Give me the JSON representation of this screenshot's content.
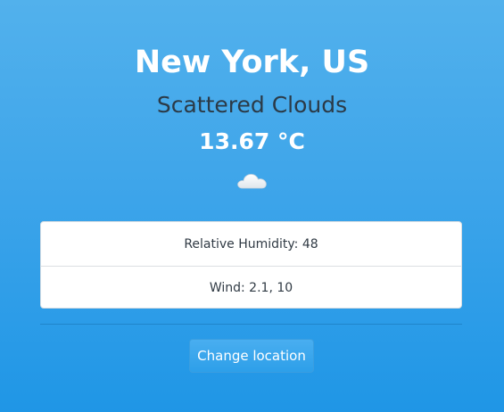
{
  "weather": {
    "location": "New York, US",
    "description": "Scattered Clouds",
    "temperature": "13.67 °C",
    "icon": "cloud-icon"
  },
  "details": {
    "humidity_text": "Relative Humidity: 48",
    "wind_text": "Wind: 2.1, 10"
  },
  "actions": {
    "change_location_label": "Change location"
  },
  "colors": {
    "background_top": "#52b1ec",
    "background_bottom": "#1f96e6",
    "description_text": "#2b3a47",
    "button": "#3aa6ee"
  }
}
